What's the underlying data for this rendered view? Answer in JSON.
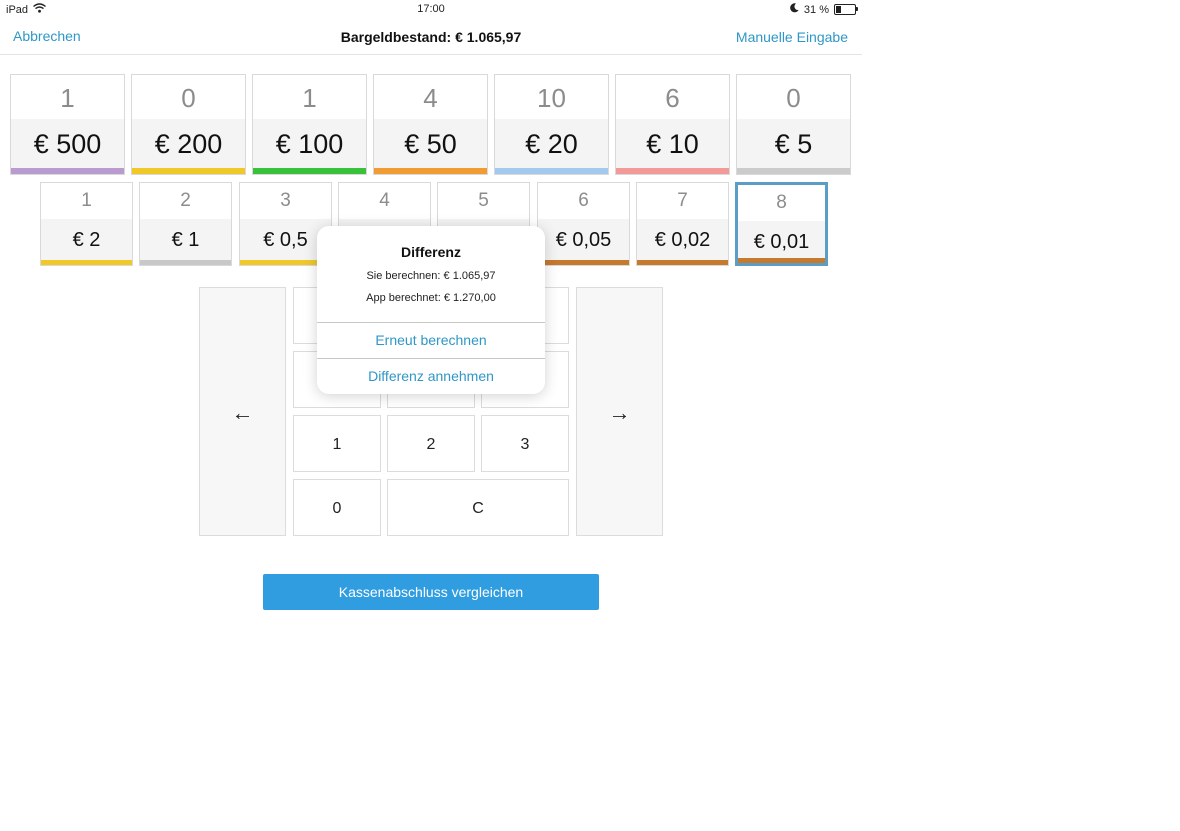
{
  "statusbar": {
    "device": "iPad",
    "time": "17:00",
    "battery": "31 %",
    "battery_level": 0.31
  },
  "navbar": {
    "cancel": "Abbrechen",
    "title": "Bargeldbestand: € 1.065,97",
    "manual": "Manuelle Eingabe"
  },
  "notes": [
    {
      "count": "1",
      "label": "€ 500",
      "color": "#b99bd0"
    },
    {
      "count": "0",
      "label": "€ 200",
      "color": "#f0c929"
    },
    {
      "count": "1",
      "label": "€ 100",
      "color": "#38c13a"
    },
    {
      "count": "4",
      "label": "€ 50",
      "color": "#f19c32"
    },
    {
      "count": "10",
      "label": "€ 20",
      "color": "#a3c9ee"
    },
    {
      "count": "6",
      "label": "€ 10",
      "color": "#f19a98"
    },
    {
      "count": "0",
      "label": "€ 5",
      "color": "#cbcbcb"
    }
  ],
  "coins": [
    {
      "count": "1",
      "label": "€ 2",
      "color": "#f0c929"
    },
    {
      "count": "2",
      "label": "€ 1",
      "color": "#c8c8c8"
    },
    {
      "count": "3",
      "label": "€ 0,5",
      "color": "#f0c929"
    },
    {
      "count": "4",
      "label": "",
      "color": "#d0892f"
    },
    {
      "count": "5",
      "label": "",
      "color": "#d0892f"
    },
    {
      "count": "6",
      "label": "€ 0,05",
      "color": "#c67a2e"
    },
    {
      "count": "7",
      "label": "€ 0,02",
      "color": "#c67a2e"
    },
    {
      "count": "8",
      "label": "€ 0,01",
      "color": "#c67a2e"
    }
  ],
  "keypad": {
    "prev": "←",
    "next": "→",
    "k1": "1",
    "k2": "2",
    "k3": "3",
    "k0": "0",
    "clear": "C"
  },
  "compare_button": "Kassenabschluss vergleichen",
  "dialog": {
    "title": "Differenz",
    "user_calc": "Sie berechnen: € 1.065,97",
    "app_calc": "App berechnet: € 1.270,00",
    "recalc": "Erneut berechnen",
    "accept": "Differenz annehmen"
  },
  "colors": {
    "accent": "#2f97c7",
    "primary_button": "#2f9de0",
    "selected_border": "#5a9ec7"
  }
}
